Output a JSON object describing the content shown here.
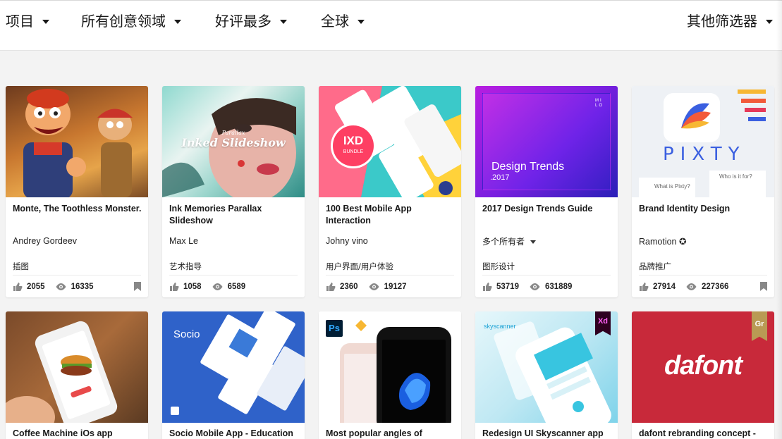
{
  "filters": {
    "projects": "项目",
    "creative_fields": "所有创意领域",
    "sort": "好评最多",
    "location": "全球",
    "more": "其他筛选器"
  },
  "cards": [
    {
      "title": "Monte, The Toothless Monster.",
      "owner": "Andrey Gordeev",
      "field": "插图",
      "likes": "2055",
      "views": "16335",
      "bookmark": true,
      "thumb": "cartoon-characters-illustration"
    },
    {
      "title": "Ink Memories Parallax Slideshow",
      "owner": "Max Le",
      "field": "艺术指导",
      "likes": "1058",
      "views": "6589",
      "bookmark": false,
      "thumb_text_small": "Parallax",
      "thumb_text": "Inked Slideshow"
    },
    {
      "title": "100 Best Mobile App Interaction",
      "owner": "Johny vino",
      "field": "用户界面/用户体验",
      "likes": "2360",
      "views": "19127",
      "bookmark": false,
      "thumb_text": "IXD",
      "thumb_text_small": "BUNDLE"
    },
    {
      "title": "2017 Design Trends Guide",
      "owner": "多个所有者",
      "field": "图形设计",
      "likes": "53719",
      "views": "631889",
      "bookmark": false,
      "thumb_text": "Design Trends",
      "thumb_text_small": ".2017",
      "thumb_mark": "MILO"
    },
    {
      "title": "Brand Identity Design",
      "owner": "Ramotion ✪",
      "field": "品牌推广",
      "likes": "27914",
      "views": "227366",
      "bookmark": true,
      "thumb_text": "PIXTY",
      "thumb_text_small": "What is Pixty?",
      "thumb_text_small2": "Who is it for?"
    }
  ],
  "cards_row2": [
    {
      "title": "Coffee Machine iOs app",
      "thumb": "phone-burger"
    },
    {
      "title": "Socio Mobile App - Education",
      "thumb_text": "Socio"
    },
    {
      "title": "Most popular angles of",
      "thumb": "iphone-mockups",
      "badge1": "Ps"
    },
    {
      "title": "Redesign UI Skyscanner app",
      "thumb_text": "skyscanner",
      "badge": "Xd"
    },
    {
      "title": "dafont rebranding concept -",
      "thumb_text": "dafont",
      "badge": "Gr"
    }
  ],
  "colors": {
    "accent_purple": "#7a1fe0",
    "dafont_red": "#c8293a",
    "socio_blue": "#2f62c9"
  }
}
